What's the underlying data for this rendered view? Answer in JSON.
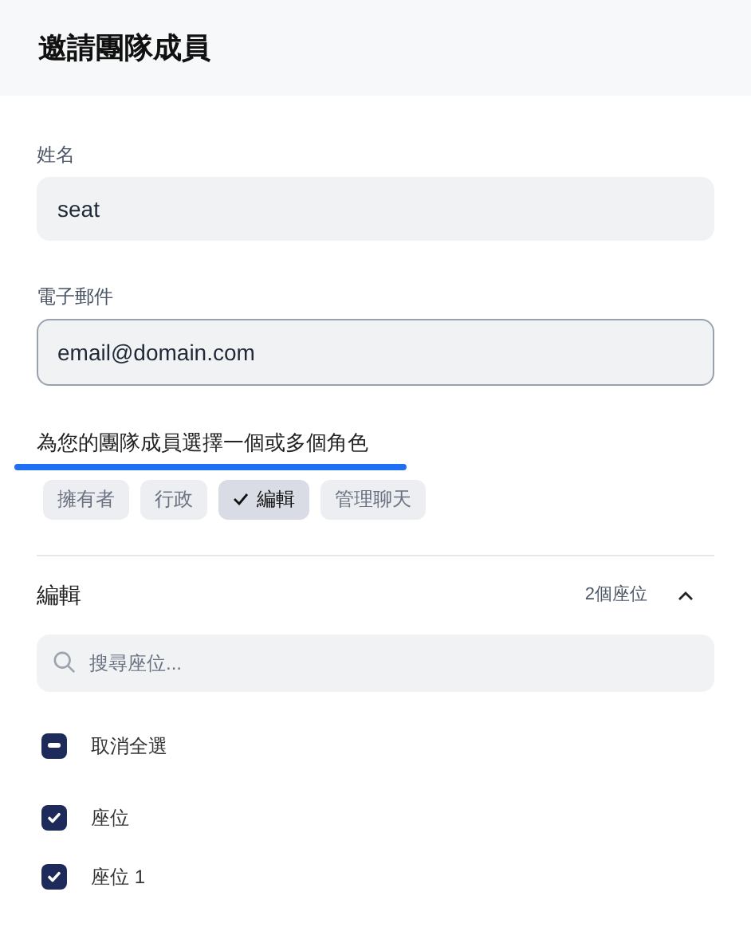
{
  "header": {
    "title": "邀請團隊成員"
  },
  "name_field": {
    "label": "姓名",
    "value": "seat"
  },
  "email_field": {
    "label": "電子郵件",
    "value": "email@domain.com",
    "focused": true
  },
  "roles": {
    "prompt": "為您的團隊成員選擇一個或多個角色",
    "underlined": true,
    "items": [
      {
        "label": "擁有者",
        "selected": false
      },
      {
        "label": "行政",
        "selected": false
      },
      {
        "label": "編輯",
        "selected": true
      },
      {
        "label": "管理聊天",
        "selected": false
      }
    ]
  },
  "section": {
    "title": "編輯",
    "count": "2個座位",
    "expanded": true,
    "search": {
      "placeholder": "搜尋座位..."
    },
    "select_all": {
      "label": "取消全選",
      "checked": true,
      "partial": true
    },
    "seats": [
      {
        "label": "座位",
        "checked": true
      },
      {
        "label": "座位 1",
        "checked": true
      }
    ]
  }
}
